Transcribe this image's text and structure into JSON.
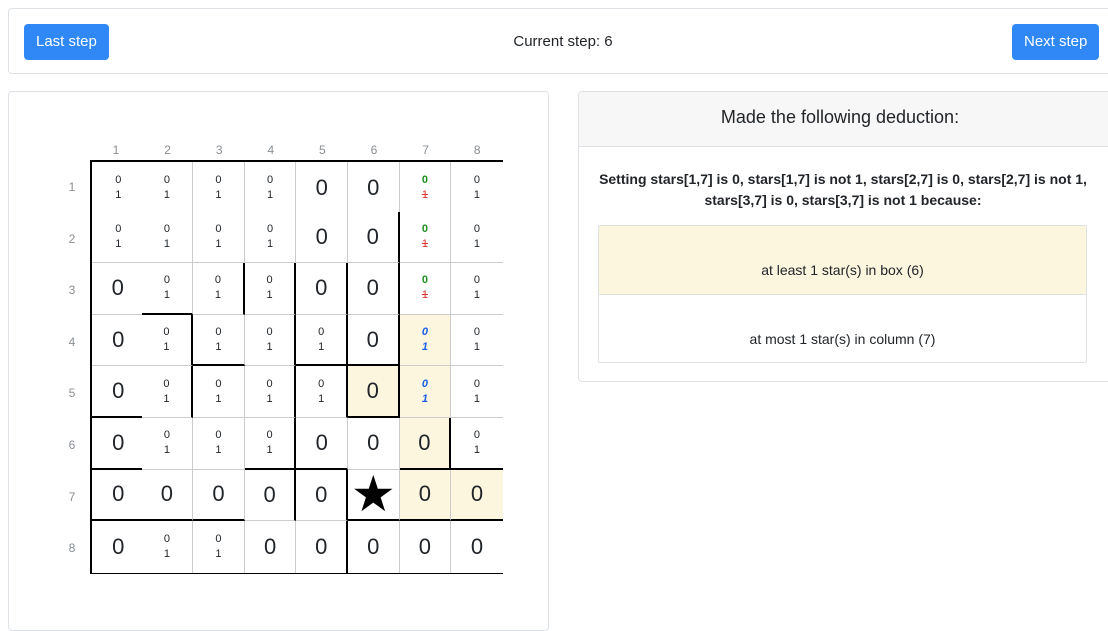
{
  "toolbar": {
    "last_step_label": "Last step",
    "next_step_label": "Next step",
    "current_step_label": "Current step:",
    "current_step_value": "6"
  },
  "grid": {
    "col_numbers": [
      "1",
      "2",
      "3",
      "4",
      "5",
      "6",
      "7",
      "8"
    ],
    "row_numbers": [
      "1",
      "2",
      "3",
      "4",
      "5",
      "6",
      "7",
      "8"
    ],
    "cells": [
      [
        {
          "t": "c"
        },
        {
          "t": "c"
        },
        {
          "t": "c"
        },
        {
          "t": "c"
        },
        {
          "t": "z"
        },
        {
          "t": "z"
        },
        {
          "t": "d"
        },
        {
          "t": "c"
        }
      ],
      [
        {
          "t": "c"
        },
        {
          "t": "c"
        },
        {
          "t": "c"
        },
        {
          "t": "c"
        },
        {
          "t": "z"
        },
        {
          "t": "z"
        },
        {
          "t": "d"
        },
        {
          "t": "c"
        }
      ],
      [
        {
          "t": "z"
        },
        {
          "t": "c"
        },
        {
          "t": "c"
        },
        {
          "t": "c"
        },
        {
          "t": "z"
        },
        {
          "t": "z"
        },
        {
          "t": "d"
        },
        {
          "t": "c"
        }
      ],
      [
        {
          "t": "z"
        },
        {
          "t": "c"
        },
        {
          "t": "c"
        },
        {
          "t": "c"
        },
        {
          "t": "c"
        },
        {
          "t": "z"
        },
        {
          "t": "i",
          "hl": true
        },
        {
          "t": "c"
        }
      ],
      [
        {
          "t": "z"
        },
        {
          "t": "c"
        },
        {
          "t": "c"
        },
        {
          "t": "c"
        },
        {
          "t": "c"
        },
        {
          "t": "z",
          "hl": true
        },
        {
          "t": "i",
          "hl": true
        },
        {
          "t": "c"
        }
      ],
      [
        {
          "t": "z"
        },
        {
          "t": "c"
        },
        {
          "t": "c"
        },
        {
          "t": "c"
        },
        {
          "t": "z"
        },
        {
          "t": "z"
        },
        {
          "t": "z",
          "hl": true
        },
        {
          "t": "c"
        }
      ],
      [
        {
          "t": "z"
        },
        {
          "t": "z"
        },
        {
          "t": "z"
        },
        {
          "t": "z"
        },
        {
          "t": "z"
        },
        {
          "t": "s"
        },
        {
          "t": "z",
          "hl": true
        },
        {
          "t": "z",
          "hl": true
        }
      ],
      [
        {
          "t": "z"
        },
        {
          "t": "c"
        },
        {
          "t": "c"
        },
        {
          "t": "z"
        },
        {
          "t": "z"
        },
        {
          "t": "z"
        },
        {
          "t": "z"
        },
        {
          "t": "z"
        }
      ]
    ],
    "zero": "0",
    "one": "1",
    "star_glyph": "★",
    "colors": {
      "highlight": "#fdf6df",
      "eliminated_zero": "#1e8f1e",
      "eliminated_one": "#e0342f",
      "involved": "#1a5fe8"
    }
  },
  "deduction": {
    "header": "Made the following deduction:",
    "text": "Setting stars[1,7] is 0, stars[1,7] is not 1, stars[2,7] is 0, stars[2,7] is not 1, stars[3,7] is 0, stars[3,7] is not 1 because:",
    "reasons": [
      {
        "label": "at least 1 star(s) in box (6)",
        "active": true
      },
      {
        "label": "at most 1 star(s) in column (7)",
        "active": false
      }
    ]
  }
}
